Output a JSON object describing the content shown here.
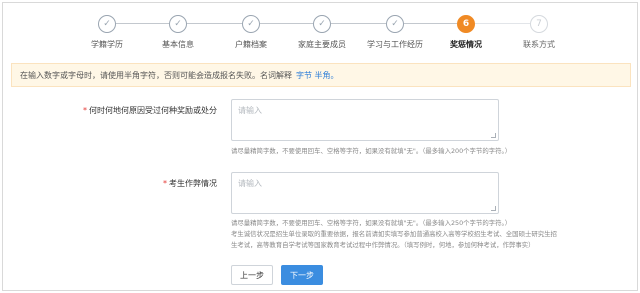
{
  "stepper": {
    "steps": [
      {
        "label": "学籍学历",
        "state": "done",
        "marker": "✓"
      },
      {
        "label": "基本信息",
        "state": "done",
        "marker": "✓"
      },
      {
        "label": "户籍档案",
        "state": "done",
        "marker": "✓"
      },
      {
        "label": "家庭主要成员",
        "state": "done",
        "marker": "✓"
      },
      {
        "label": "学习与工作经历",
        "state": "done",
        "marker": "✓"
      },
      {
        "label": "奖惩情况",
        "state": "active",
        "marker": "6"
      },
      {
        "label": "联系方式",
        "state": "pending",
        "marker": "7"
      }
    ]
  },
  "notice": {
    "text": "在输入数字或字母时，请使用半角字符，否则可能会造成报名失败。名词解释",
    "link": "字节 半角。"
  },
  "form": {
    "reward_label": "何时何地何原因受过何种奖励或处分",
    "reward_required_mark": "*",
    "reward_placeholder": "请输入",
    "reward_hint": "请尽量精简字数，不要使用回车、空格等字符，如果没有就填\"无\"。（最多输入200个字节的字符。）",
    "integrity_label": "考生作弊情况",
    "integrity_required_mark": "*",
    "integrity_placeholder": "请输入",
    "integrity_hint_1": "请尽量精简字数，不要使用回车、空格等字符，如果没有就填\"无\"。（最多输入250个字节的字符。）",
    "integrity_hint_2": "考生诚信状况是招生单位录取的重要依据，报名前请如实填写参加普通高校入高等学校招生考试、全国硕士研究生招",
    "integrity_hint_3": "生考试，高等教育自学考试等国家教育考试过程中作弊情况。（填写例时，何地，参加何种考试，作弊事实）"
  },
  "actions": {
    "prev_label": "上一步",
    "next_label": "下一步"
  }
}
